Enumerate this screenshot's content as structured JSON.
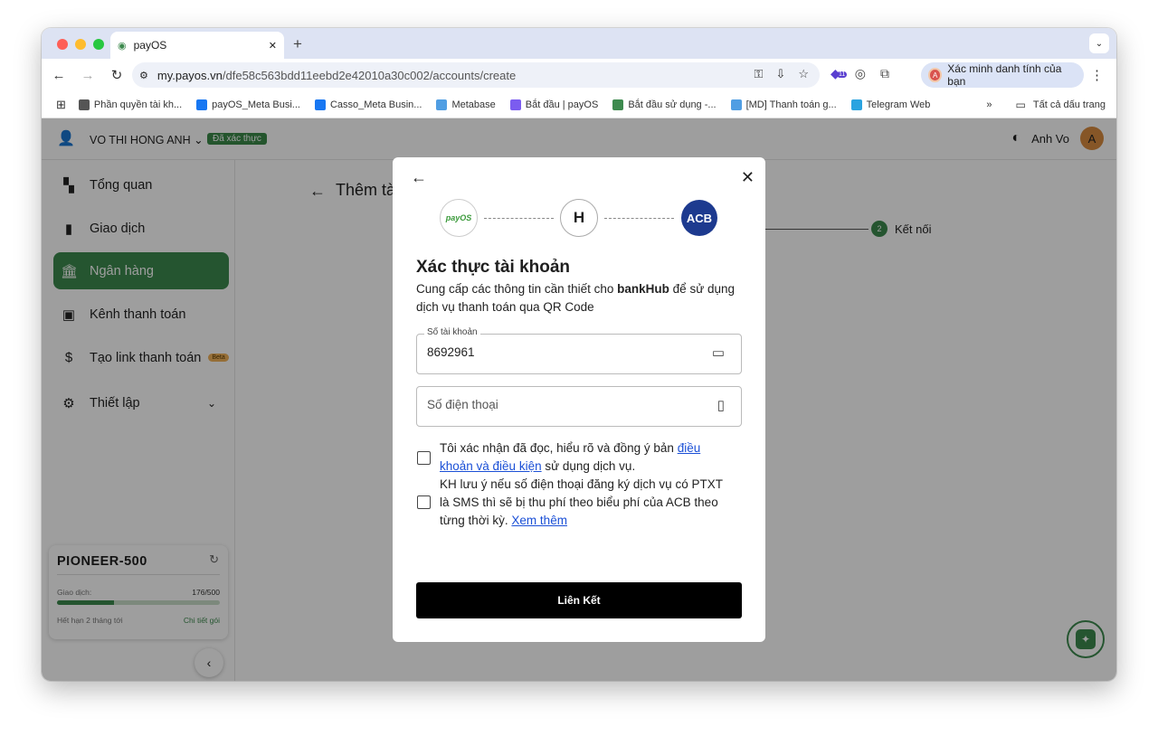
{
  "browser": {
    "tab_title": "payOS",
    "new_tab_icon": "+",
    "url_domain": "my.payos.vn",
    "url_path": "/dfe58c563bdd11eebd2e42010a30c002/accounts/create",
    "profile_label": "Xác minh danh tính của bạn",
    "extension_badge": "11",
    "bookmarks": [
      {
        "label": "Phần quyền tài kh...",
        "color": "#555555"
      },
      {
        "label": "payOS_Meta Busi...",
        "color": "#1877f2"
      },
      {
        "label": "Casso_Meta Busin...",
        "color": "#1877f2"
      },
      {
        "label": "Metabase",
        "color": "#509ee3"
      },
      {
        "label": "Bắt đầu | payOS",
        "color": "#7b5cf0"
      },
      {
        "label": "Bắt đầu sử dụng -...",
        "color": "#3d8a4e"
      },
      {
        "label": "[MD] Thanh toán g...",
        "color": "#509ee3"
      },
      {
        "label": "Telegram Web",
        "color": "#2aa3e0"
      }
    ],
    "all_bookmarks": "Tất cả dấu trang"
  },
  "header": {
    "user_name": "VO THI HONG ANH",
    "verified_badge": "Đã xác thực",
    "display_name": "Anh Vo",
    "avatar_letter": "A"
  },
  "sidebar": {
    "items": [
      {
        "label": "Tổng quan",
        "icon": "dashboard-icon"
      },
      {
        "label": "Giao dịch",
        "icon": "bar-chart-icon"
      },
      {
        "label": "Ngân hàng",
        "icon": "bank-icon"
      },
      {
        "label": "Kênh thanh toán",
        "icon": "wallet-icon"
      },
      {
        "label": "Tạo link thanh toán",
        "icon": "document-icon",
        "badge": "Beta"
      },
      {
        "label": "Thiết lập",
        "icon": "gear-icon"
      }
    ]
  },
  "plan": {
    "name": "PIONEER-500",
    "transactions_label": "Giao dịch:",
    "transactions_count": "176/500",
    "usage_fraction": 0.352,
    "expiry": "Hết hạn 2 tháng tới",
    "details_link": "Chi tiết gói"
  },
  "main": {
    "page_title": "Thêm tà",
    "step_number": "2",
    "step_label": "Kết nối"
  },
  "modal": {
    "logos": {
      "payos": "payOS",
      "bankhub": "H",
      "acb": "ACB"
    },
    "title": "Xác thực tài khoản",
    "desc_prefix": "Cung cấp các thông tin cần thiết cho ",
    "desc_bold": "bankHub",
    "desc_suffix": " để sử dụng dịch vụ thanh toán qua QR Code",
    "account_label": "Số tài khoản",
    "account_value": "8692961",
    "phone_placeholder": "Số điện thoại",
    "consent1_prefix": "Tôi xác nhận đã đọc, hiểu rõ và đồng ý bản ",
    "consent1_link": "điều khoản và điều kiện",
    "consent1_suffix": " sử dụng dịch vụ.",
    "consent2_text": "KH lưu ý nếu số điện thoại đăng ký dịch vụ có PTXT là SMS thì sẽ bị thu phí theo biểu phí của ACB theo từng thời kỳ. ",
    "consent2_link": "Xem thêm",
    "submit_label": "Liên Kết"
  },
  "colors": {
    "brand": "#3d8a4e",
    "acb": "#1d3a8f",
    "link": "#1a4fd6"
  }
}
